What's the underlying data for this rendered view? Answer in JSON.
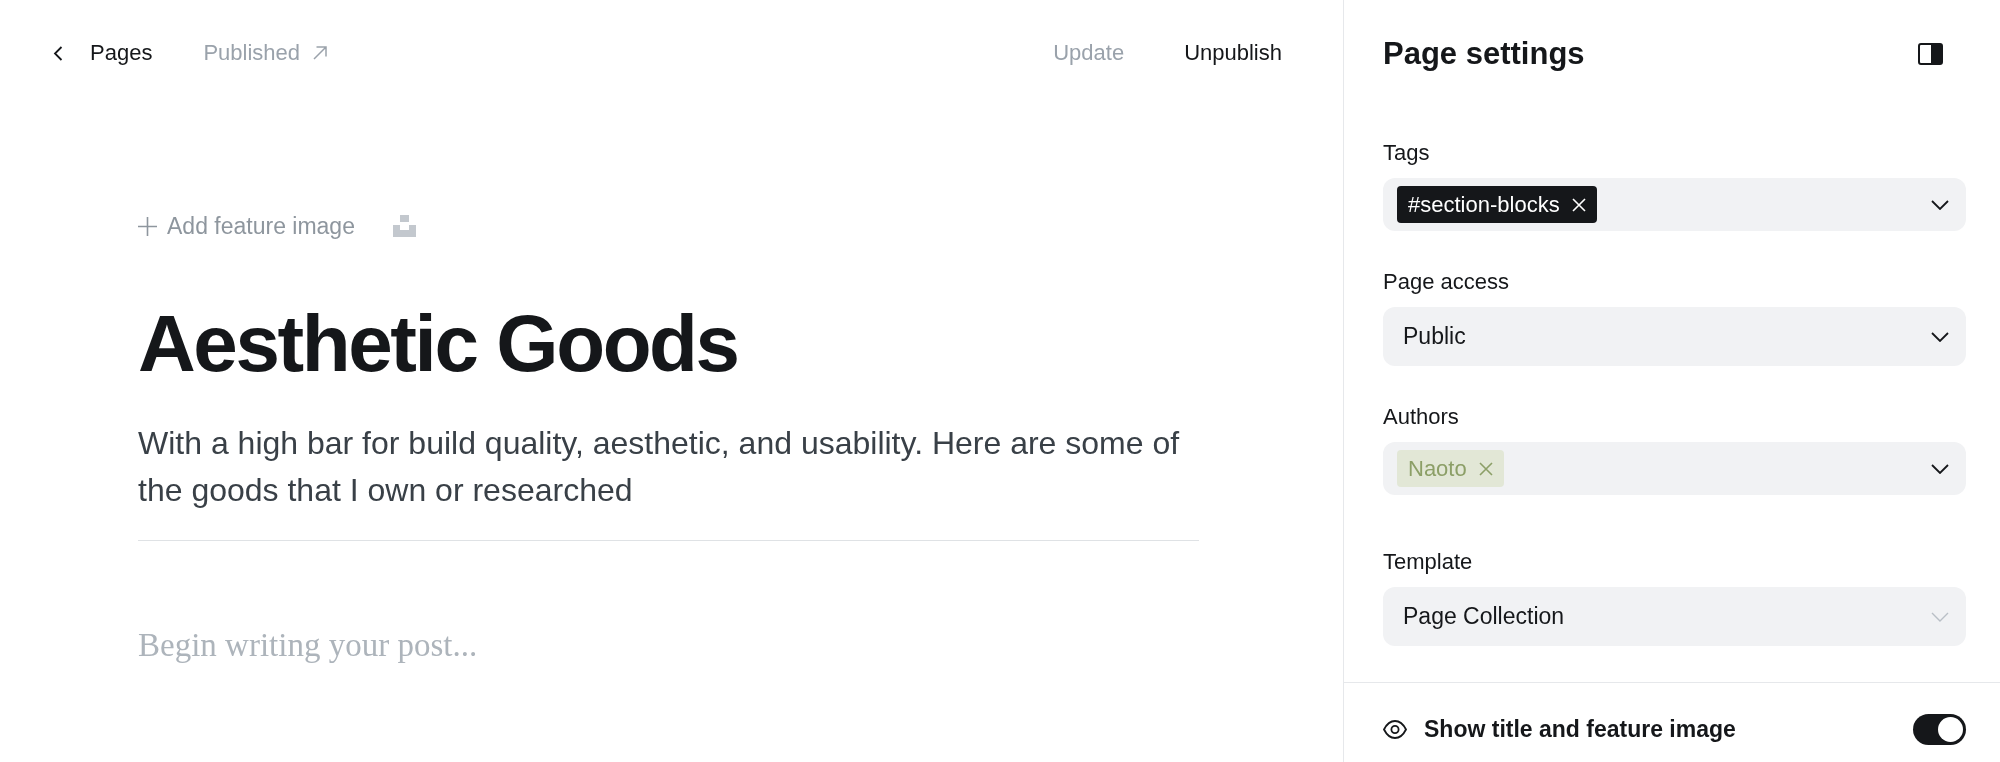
{
  "header": {
    "back_link": {
      "label": "Pages"
    },
    "status_link": {
      "label": "Published"
    },
    "actions": [
      {
        "label": "Update",
        "disabled": true
      },
      {
        "label": "Unpublish",
        "disabled": false
      }
    ]
  },
  "editor": {
    "feature_image": {
      "label": "Add feature image"
    },
    "title": "Aesthetic Goods",
    "excerpt": "With a high bar for build quality, aesthetic, and usability. Here are some of the goods that I own or researched",
    "body": {
      "placeholder": "Begin writing your post..."
    }
  },
  "settings": {
    "title": "Page settings",
    "fields": [
      {
        "label": "Tags",
        "kind": "tags",
        "chips": [
          "#section-blocks"
        ]
      },
      {
        "label": "Page access",
        "kind": "select",
        "value": "Public"
      },
      {
        "label": "Authors",
        "kind": "authors",
        "chips": [
          "Naoto"
        ]
      },
      {
        "label": "Template",
        "kind": "native-select",
        "value": "Page Collection"
      }
    ],
    "toggle": {
      "label": "Show title and feature image",
      "on": true
    }
  }
}
